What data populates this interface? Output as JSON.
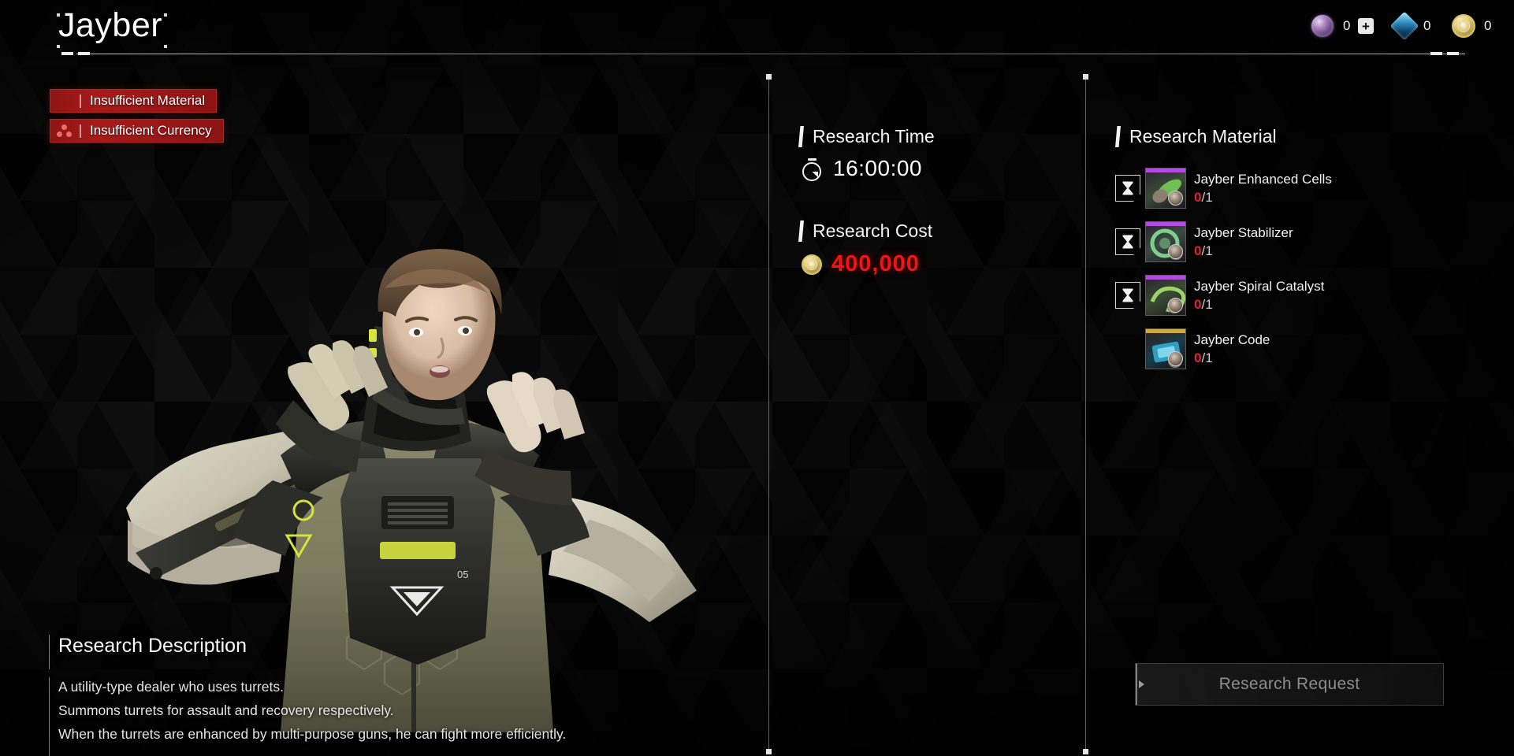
{
  "header": {
    "title": "Jayber"
  },
  "currencies": [
    {
      "id": "premium-orb",
      "icon": "orb-icon",
      "value": "0",
      "has_plus": true,
      "plus_label": "+"
    },
    {
      "id": "blue-crystal",
      "icon": "gem-icon",
      "value": "0",
      "has_plus": false,
      "plus_label": ""
    },
    {
      "id": "gold-coin",
      "icon": "coin-icon",
      "value": "0",
      "has_plus": false,
      "plus_label": ""
    }
  ],
  "warnings": [
    {
      "icon": "hex-plus-icon",
      "label": "Insufficient Material"
    },
    {
      "icon": "three-dots-icon",
      "label": "Insufficient Currency"
    }
  ],
  "research_time": {
    "title": "Research Time",
    "icon": "stopwatch-icon",
    "value": "16:00:00"
  },
  "research_cost": {
    "title": "Research Cost",
    "icon": "coin-icon",
    "value": "400,000",
    "color": "#f01414"
  },
  "research_material": {
    "title": "Research Material",
    "items": [
      {
        "name": "Jayber Enhanced Cells",
        "have": "0",
        "separator": "/",
        "need": "1",
        "badge": "hourglass-icon",
        "has_badge": true,
        "rarity_color": "#b44ae0",
        "art_color_a": "#6fbf55",
        "art_color_b": "#3d4a38"
      },
      {
        "name": "Jayber Stabilizer",
        "have": "0",
        "separator": "/",
        "need": "1",
        "badge": "hourglass-icon",
        "has_badge": true,
        "rarity_color": "#b44ae0",
        "art_color_a": "#7fcf8c",
        "art_color_b": "#394a42"
      },
      {
        "name": "Jayber Spiral Catalyst",
        "have": "0",
        "separator": "/",
        "need": "1",
        "badge": "hourglass-icon",
        "has_badge": true,
        "rarity_color": "#b44ae0",
        "art_color_a": "#9ed36a",
        "art_color_b": "#3a4a33"
      },
      {
        "name": "Jayber Code",
        "have": "0",
        "separator": "/",
        "need": "1",
        "badge": "",
        "has_badge": false,
        "rarity_color": "#cfa94a",
        "art_color_a": "#4fc8e8",
        "art_color_b": "#1a3b4a"
      }
    ]
  },
  "research_request": {
    "label": "Research Request",
    "enabled": false
  },
  "research_description": {
    "title": "Research Description",
    "lines": [
      "A utility-type dealer who uses turrets.",
      "Summons turrets for assault and recovery respectively.",
      "When the turrets are enhanced by multi-purpose guns, he can fight more efficiently."
    ]
  }
}
